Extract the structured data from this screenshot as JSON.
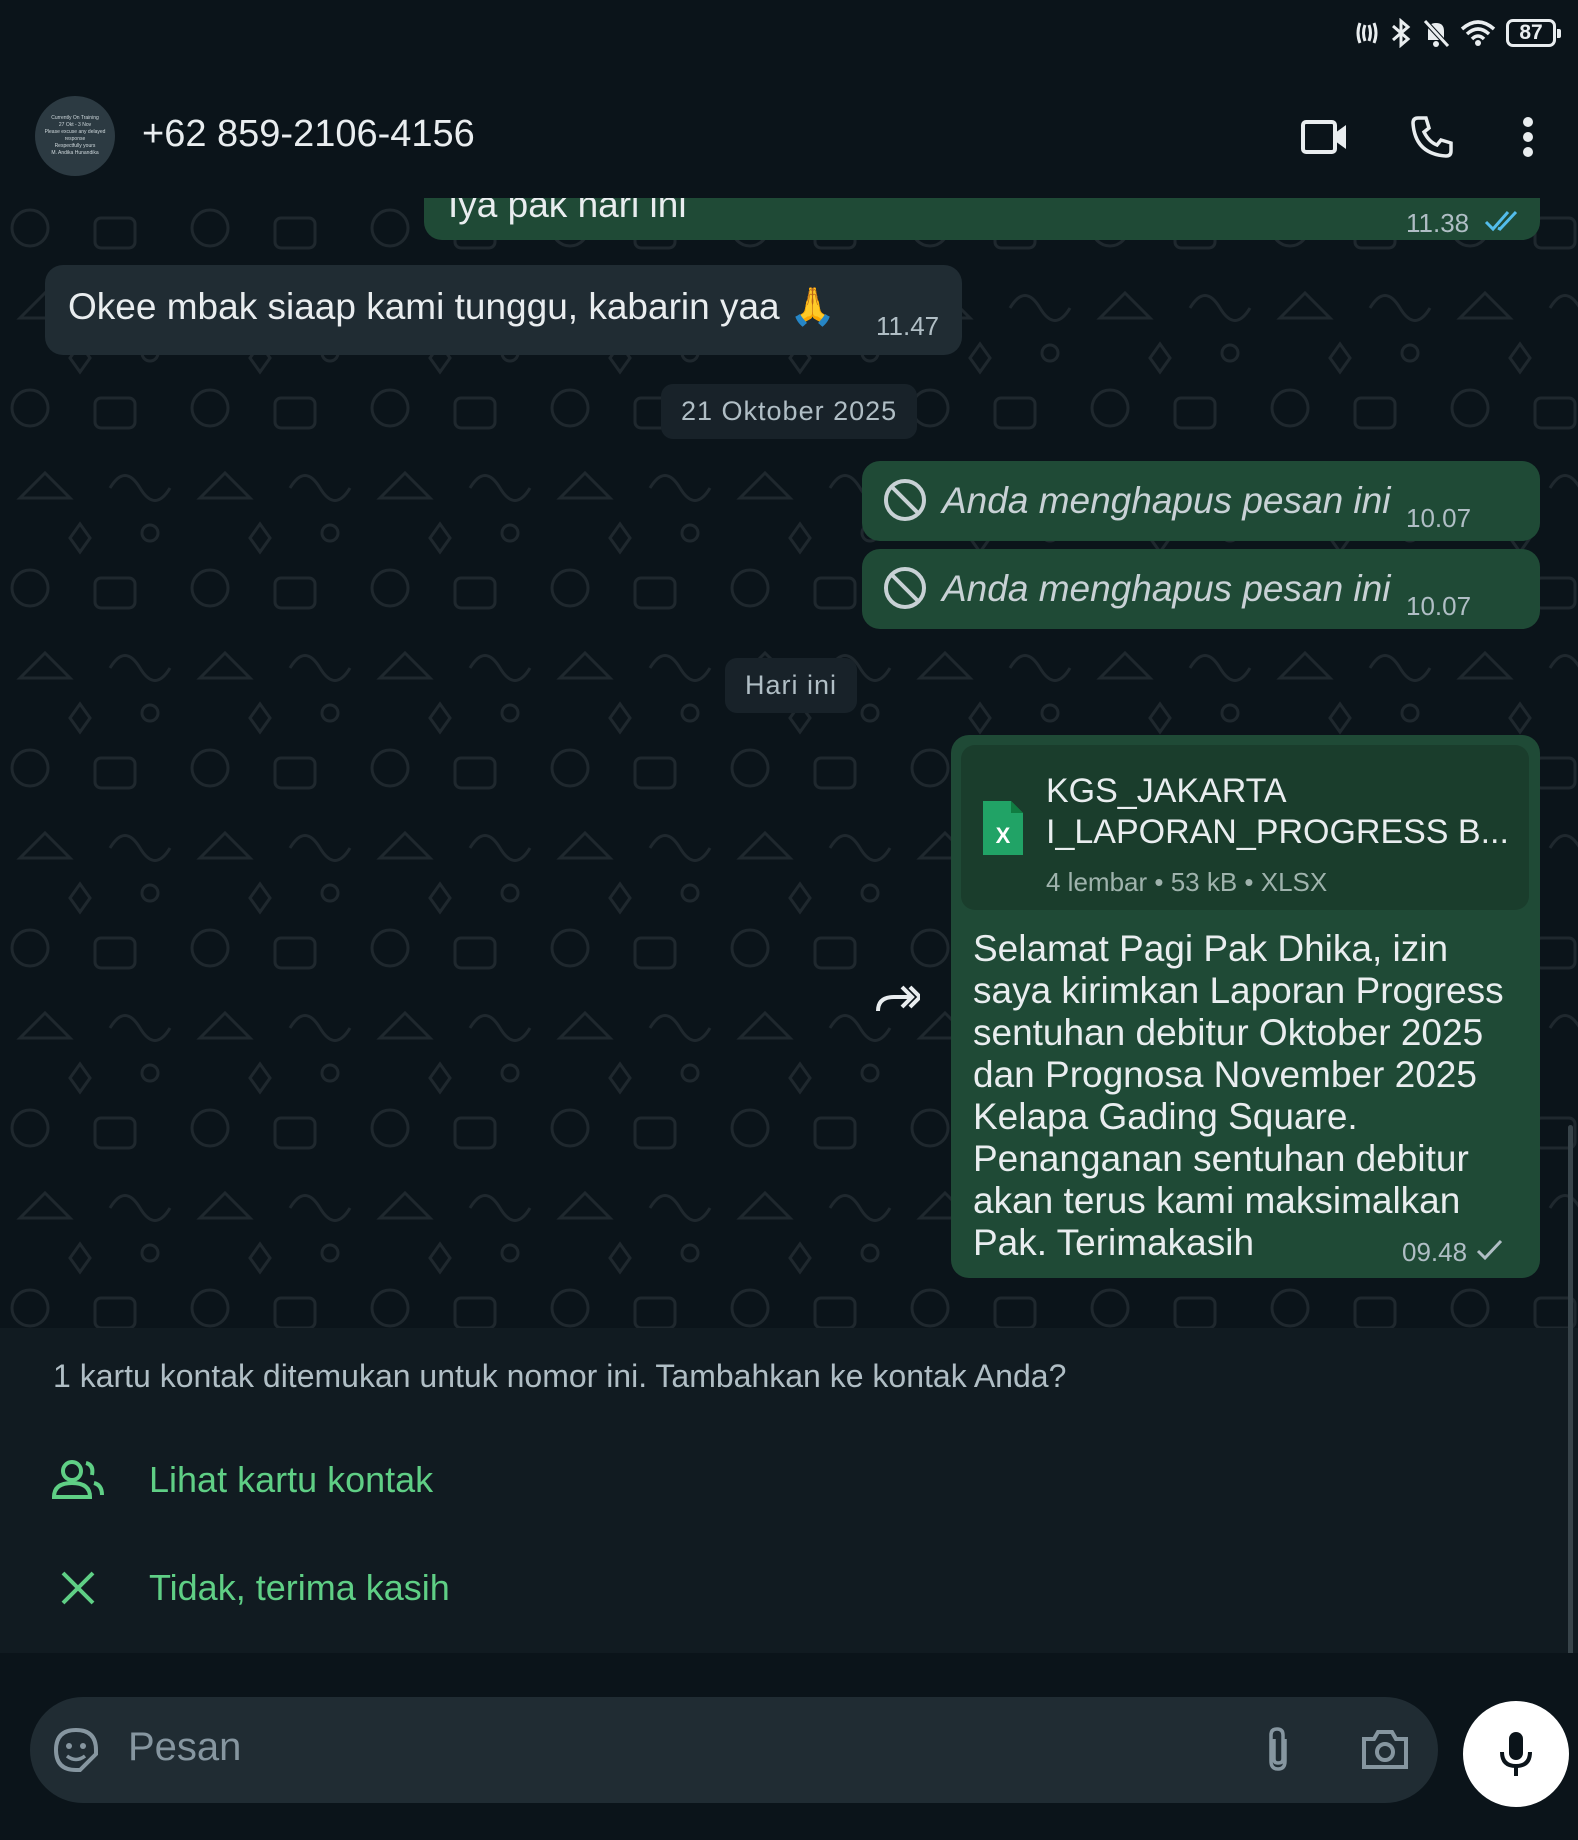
{
  "status": {
    "battery": "87"
  },
  "header": {
    "contact": "+62 859-2106-4156"
  },
  "avatar_text": [
    "Currently On Training",
    "27 Okt - 3 Nov",
    "Please excuse any delayed",
    "response",
    "Respectfully yours",
    "M. Andika Hunandika"
  ],
  "messages": {
    "m1": {
      "text": "Iya pak hari ini",
      "time": "11.38"
    },
    "m2": {
      "text": "Okee mbak siaap kami tunggu, kabarin yaa 🙏",
      "time": "11.47"
    },
    "date1": "21 Oktober 2025",
    "m3": {
      "text": "Anda menghapus pesan ini",
      "time": "10.07"
    },
    "m4": {
      "text": "Anda menghapus pesan ini",
      "time": "10.07"
    },
    "date2": "Hari ini",
    "m5": {
      "file_line1": "KGS_JAKARTA",
      "file_line2": "I_LAPORAN_PROGRESS B...",
      "file_meta": "4 lembar  •  53 kB  •  XLSX",
      "text": "Selamat Pagi Pak Dhika, izin saya kirimkan Laporan Progress sentuhan debitur Oktober 2025 dan Prognosa November 2025 Kelapa Gading Square. Penanganan sentuhan debitur akan terus kami maksimalkan Pak. Terimakasih",
      "time": "09.48"
    }
  },
  "banner": {
    "text": "1 kartu kontak ditemukan untuk nomor ini. Tambahkan ke kontak Anda?",
    "view_label": "Lihat kartu kontak",
    "dismiss_label": "Tidak, terima kasih"
  },
  "composer": {
    "placeholder": "Pesan"
  },
  "colors": {
    "accent": "#5fcf85",
    "outgoing": "#1f4a36",
    "incoming": "#202c33",
    "read_tick": "#53bdeb"
  }
}
